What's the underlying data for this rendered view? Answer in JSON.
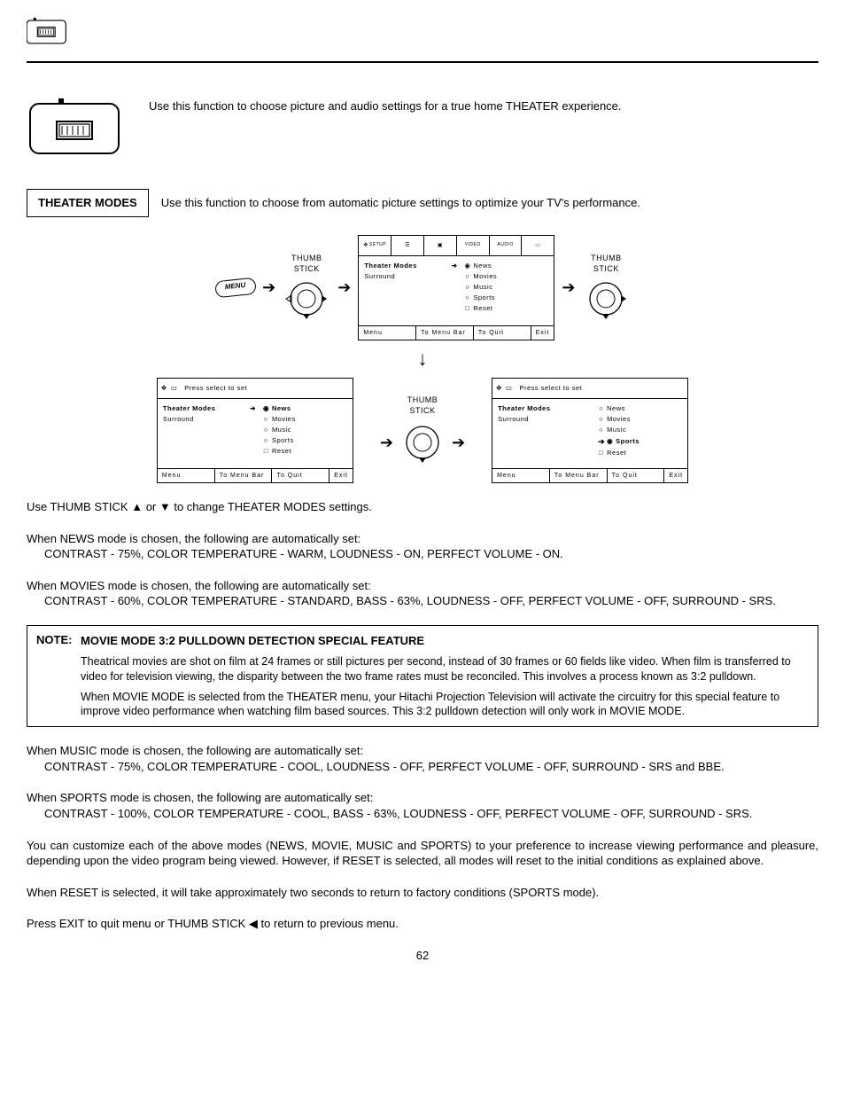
{
  "intro": {
    "theater_desc": "Use this function to choose picture and audio settings for a true home THEATER experience.",
    "mode_label": "THEATER MODES",
    "mode_desc": "Use this function to choose from automatic picture settings to optimize your TV's performance."
  },
  "diagram": {
    "menu_btn": "MENU",
    "thumb": "THUMB",
    "stick": "STICK",
    "topbar": {
      "setup": "SETUP",
      "video": "VIDEO",
      "audio": "AUDIO"
    },
    "press_select": "Press select to set",
    "left_items": {
      "theater": "Theater Modes",
      "surround": "Surround"
    },
    "right_items": {
      "news": "News",
      "movies": "Movies",
      "music": "Music",
      "sports": "Sports",
      "reset": "Reset"
    },
    "foot": {
      "menu": "Menu",
      "bar": "To Menu Bar",
      "quit": "To Quit",
      "exit": "Exit"
    }
  },
  "body": {
    "use_thumb": "Use THUMB STICK ▲ or ▼ to change THEATER MODES settings.",
    "news_h": "When NEWS mode is chosen, the following are automatically set:",
    "news_d": "CONTRAST - 75%, COLOR TEMPERATURE - WARM, LOUDNESS - ON, PERFECT VOLUME - ON.",
    "movies_h": "When MOVIES mode is chosen, the following are automatically set:",
    "movies_d": "CONTRAST - 60%, COLOR TEMPERATURE - STANDARD, BASS - 63%, LOUDNESS - OFF, PERFECT VOLUME - OFF, SURROUND - SRS.",
    "music_h": "When MUSIC mode is chosen, the following are automatically set:",
    "music_d": "CONTRAST - 75%, COLOR TEMPERATURE - COOL, LOUDNESS - OFF, PERFECT VOLUME - OFF, SURROUND - SRS and BBE.",
    "sports_h": "When SPORTS mode is chosen, the following are automatically set:",
    "sports_d": "CONTRAST - 100%, COLOR TEMPERATURE - COOL, BASS - 63%, LOUDNESS - OFF, PERFECT VOLUME - OFF, SURROUND - SRS.",
    "customize": "You can customize each of the above modes (NEWS, MOVIE, MUSIC and SPORTS) to your preference to increase viewing performance and pleasure, depending upon the video program being viewed. However, if RESET is selected, all modes will reset to the initial conditions as explained above.",
    "reset": "When RESET is selected, it will take approximately two seconds to return to factory conditions (SPORTS mode).",
    "exit": "Press EXIT to quit menu or THUMB STICK ◀ to return to previous menu."
  },
  "note": {
    "tag": "NOTE:",
    "title": "MOVIE MODE 3:2 PULLDOWN DETECTION SPECIAL FEATURE",
    "p1": "Theatrical movies are shot on film at 24 frames or still pictures per second, instead of 30 frames or 60 fields like video.  When film is transferred to video for television viewing, the disparity between the two frame rates must be reconciled.  This involves a process known as 3:2 pulldown.",
    "p2": "When MOVIE MODE is selected from the THEATER menu, your Hitachi Projection Television will activate the circuitry for this special feature to improve video performance when watching film based sources.  This 3:2 pulldown detection will only work in MOVIE MODE."
  },
  "page": "62"
}
